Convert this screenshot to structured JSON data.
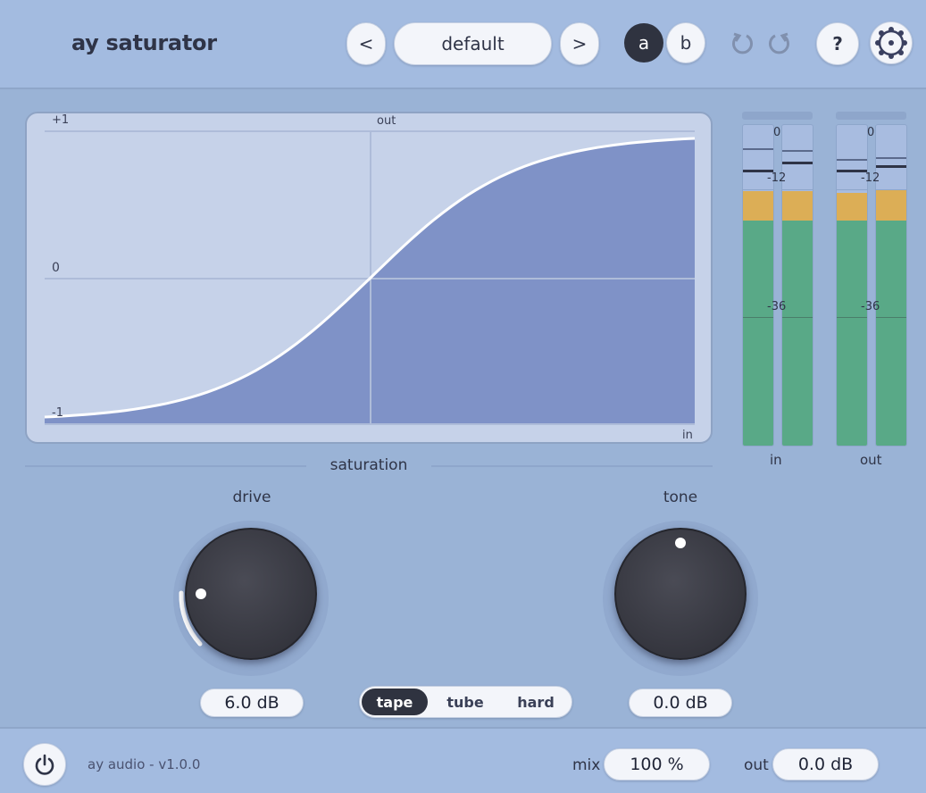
{
  "app": {
    "name": "ay saturator",
    "vendor_version": "ay audio - v1.0.0"
  },
  "header": {
    "prev_label": "<",
    "preset_name": "default",
    "next_label": ">",
    "a_label": "a",
    "b_label": "b",
    "help_label": "?"
  },
  "graph": {
    "label_top": "+1",
    "label_mid": "0",
    "label_bottom": "-1",
    "axis_out": "out",
    "axis_in": "in"
  },
  "meters": {
    "in_label": "in",
    "out_label": "out",
    "scale": [
      "0",
      "-12",
      "-36"
    ]
  },
  "section_title": "saturation",
  "drive": {
    "label": "drive",
    "value": "6.0 dB"
  },
  "tone": {
    "label": "tone",
    "value": "0.0 dB"
  },
  "modes": {
    "options": [
      "tape",
      "tube",
      "hard"
    ],
    "selected": "tape"
  },
  "footer": {
    "mix_label": "mix",
    "mix_value": "100 %",
    "out_label": "out",
    "out_value": "0.0 dB"
  },
  "colors": {
    "accent": "#2f3447",
    "logo": "#c8632a",
    "meter_green": "#59a987",
    "meter_orange": "#dcae56",
    "curve_fill": "#7f92c7"
  }
}
